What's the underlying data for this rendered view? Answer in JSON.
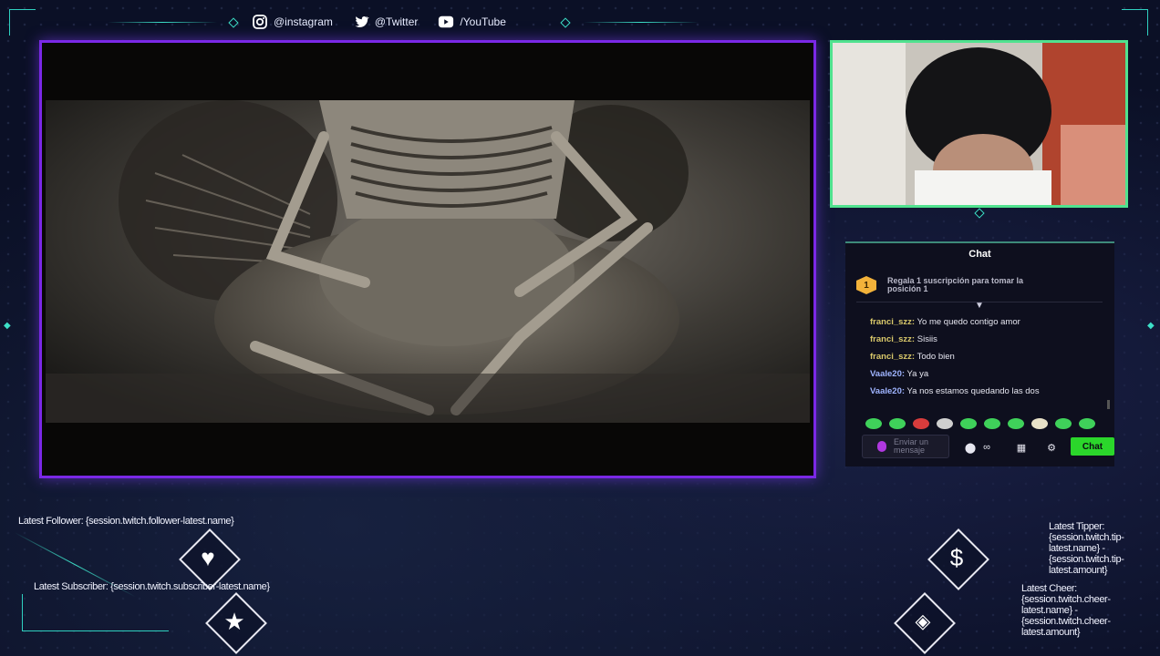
{
  "social": {
    "instagram": "@instagram",
    "twitter": "@Twitter",
    "youtube": "/YouTube"
  },
  "chat": {
    "title": "Chat",
    "sub_badge": "1",
    "sub_promo": "Regala 1 suscripción para tomar la posición 1",
    "messages": [
      {
        "user": "franci_szz:",
        "text": " Yo me quedo contigo amor"
      },
      {
        "user": "franci_szz:",
        "text": " Sisiis"
      },
      {
        "user": "franci_szz:",
        "text": " Todo bien"
      },
      {
        "user": "Vaale20:",
        "text": " Ya ya"
      },
      {
        "user": "Vaale20:",
        "text": " Ya nos estamos quedando las dos"
      }
    ],
    "input_placeholder": "Enviar un mensaje",
    "send_label": "Chat"
  },
  "alerts": {
    "latest_follower": "Latest Follower: {session.twitch.follower-latest.name}",
    "latest_subscriber": "Latest Subscriber: {session.twitch.subscriber-latest.name}",
    "latest_tipper": "Latest Tipper: {session.twitch.tip-latest.name} - {session.twitch.tip-latest.amount}",
    "latest_cheer": "Latest Cheer: {session.twitch.cheer-latest.name} - {session.twitch.cheer-latest.amount}"
  },
  "icons": {
    "heart": "heart-icon",
    "star": "star-icon",
    "dollar": "dollar-icon",
    "gem": "gem-icon"
  },
  "colors": {
    "frame_purple": "#7a28e6",
    "webcam_green": "#50e28f",
    "accent_teal": "#3de0c8",
    "chat_button": "#2bd62b"
  }
}
